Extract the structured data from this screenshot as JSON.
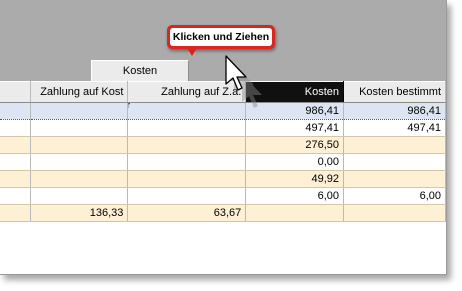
{
  "tooltip": {
    "text": "Klicken und Ziehen"
  },
  "drag_header": {
    "label": "Kosten"
  },
  "columns": [
    "",
    "Zahlung auf Kost",
    "Zahlung auf Z.a.",
    "Kosten",
    "Kosten bestimmt"
  ],
  "rows": [
    {
      "cells": [
        "",
        "",
        "",
        "986,41",
        "986,41"
      ],
      "style": "sel"
    },
    {
      "cells": [
        "",
        "",
        "",
        "497,41",
        "497,41"
      ],
      "style": "white"
    },
    {
      "cells": [
        "",
        "",
        "",
        "276,50",
        ""
      ],
      "style": "tan"
    },
    {
      "cells": [
        "",
        "",
        "",
        "0,00",
        ""
      ],
      "style": "white"
    },
    {
      "cells": [
        "",
        "",
        "",
        "49,92",
        ""
      ],
      "style": "tan"
    },
    {
      "cells": [
        "",
        "",
        "",
        "6,00",
        "6,00"
      ],
      "style": "white"
    },
    {
      "cells": [
        "",
        "136,33",
        "63,67",
        "",
        ""
      ],
      "style": "tan"
    }
  ],
  "colors": {
    "topbar": "#ababab",
    "active_header": "#101010",
    "tooltip_border": "#d8271f",
    "selected_row": "#dbe6f2",
    "tan_row": "#fdf0d5",
    "sort_arrow": "#22b14c"
  },
  "icons": {
    "sort": "sort-up-arrow-icon",
    "cursor": "drag-cursor-icon"
  }
}
